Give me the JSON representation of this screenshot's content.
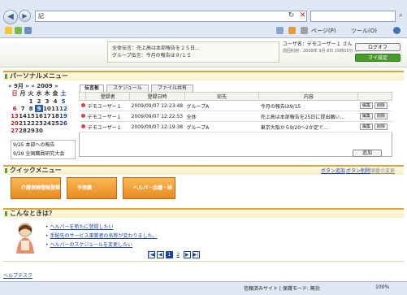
{
  "browser": {
    "address": "記",
    "toolbar": {
      "page_label": "ページ(P)",
      "tools_label": "ツール(O)"
    }
  },
  "header": {
    "notice_line1": "全体伝言：売上高は本部報告を２５日...",
    "notice_line2": "グループ伝言：今月の報告は９/１５",
    "user_line1": "ユーザ名：デモユーザー１ さん",
    "user_line2": "前回利用：2009年 9月 8日 15時15分 ...",
    "logoff": "ログオフ",
    "my_settings": "マイ設定"
  },
  "personal": {
    "title": "パーソナルメニュー",
    "cal_month": "9月",
    "cal_year": "2009",
    "weekdays": [
      "日",
      "月",
      "火",
      "水",
      "木",
      "金",
      "土"
    ],
    "weeks": [
      [
        "",
        "",
        "1",
        "2",
        "3",
        "4",
        "5"
      ],
      [
        "6",
        "7",
        "8",
        "9",
        "10",
        "11",
        "12"
      ],
      [
        "13",
        "14",
        "15",
        "16",
        "17",
        "18",
        "19"
      ],
      [
        "20",
        "21",
        "22",
        "23",
        "24",
        "25",
        "26"
      ],
      [
        "27",
        "28",
        "29",
        "30",
        "",
        "",
        ""
      ]
    ],
    "events": [
      "9/25 本部への報告",
      "9/29 全国職員研究大会"
    ],
    "tabs": [
      "伝言板",
      "スケジュール",
      "ファイル共有"
    ],
    "columns": [
      "登録者",
      "登録日時",
      "宛先",
      "内容"
    ],
    "rows": [
      {
        "user": "デモユーザー１",
        "date": "2009/09/07 12:23:48",
        "to": "グループA",
        "content": "今月の報告は9/15"
      },
      {
        "user": "デモユーザー１",
        "date": "2009/09/07 12:22:53",
        "to": "全体",
        "content": "売上高は本部報告を25日に提出願い..."
      },
      {
        "user": "デモユーザー１",
        "date": "2009/09/07 12:19:38",
        "to": "グループA",
        "content": "東京大阪から9/20〜2か定で..."
      }
    ],
    "edit": "編集",
    "delete": "削除",
    "add": "追加"
  },
  "quick": {
    "title": "クイックメニュー",
    "right_links": [
      "ボタン追加",
      "ボタン削除",
      "順番の変更"
    ],
    "buttons": [
      "介護保険情報登録",
      "予実績",
      "ヘルパー会議・研修"
    ]
  },
  "help": {
    "title": "こんなときは？",
    "links": [
      "ヘルパーを新たに登録したい",
      "手配先のサービス事業者の名称が変わりました。",
      "ヘルパーのスケジュールを変更したい"
    ],
    "pages": [
      "1",
      "2"
    ]
  },
  "footer": {
    "link": "ヘルプデスク"
  },
  "status": {
    "zone": "信頼済みサイト | 保護モード: 無効",
    "zoom": "100%"
  }
}
